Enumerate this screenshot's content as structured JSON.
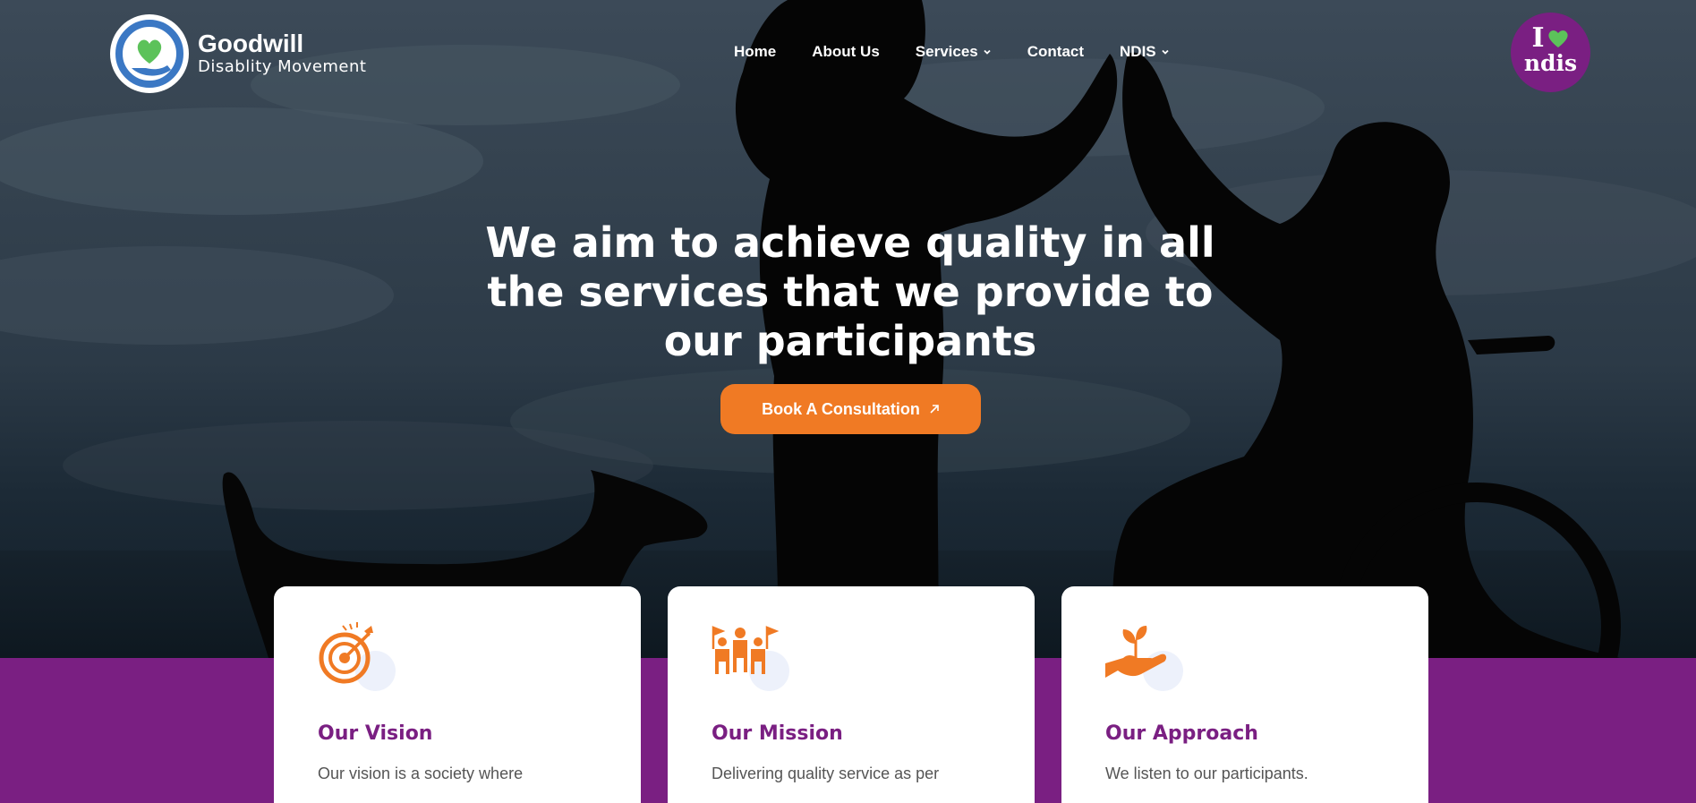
{
  "header": {
    "logo_name": "Goodwill",
    "logo_tagline": "Disablity Movement",
    "nav": [
      {
        "label": "Home"
      },
      {
        "label": "About Us"
      },
      {
        "label": "Services"
      },
      {
        "label": "Contact"
      },
      {
        "label": "NDIS"
      }
    ],
    "ndis_badge": {
      "top": "I",
      "bottom": "ndis"
    }
  },
  "hero": {
    "title": "We aim to achieve quality in all the services that we provide to our participants",
    "cta_label": "Book A Consultation"
  },
  "cards": [
    {
      "title": "Our Vision",
      "text": "Our vision is a society where",
      "icon": "target-arrow-icon"
    },
    {
      "title": "Our Mission",
      "text": "Delivering quality service as per",
      "icon": "team-flags-icon"
    },
    {
      "title": "Our Approach",
      "text": "We listen to our participants.",
      "icon": "hand-plant-icon"
    }
  ],
  "colors": {
    "brand_purple": "#7a1f82",
    "accent_orange": "#f07a24",
    "logo_blue": "#3b78c4",
    "logo_green": "#5cc25a"
  }
}
